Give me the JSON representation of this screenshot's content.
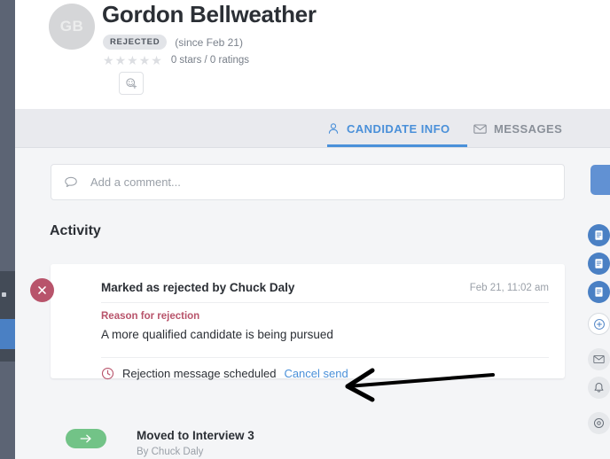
{
  "candidate": {
    "initials": "GB",
    "name": "Gordon Bellweather",
    "status_badge": "REJECTED",
    "status_since": "(since Feb 21)",
    "ratings_text": "0 stars / 0 ratings",
    "star_count": 5,
    "add_reaction_icon": "add-emoji-icon"
  },
  "tabs": [
    {
      "label": "CANDIDATE INFO",
      "icon": "person-icon",
      "active": true
    },
    {
      "label": "MESSAGES",
      "icon": "envelope-icon",
      "active": false
    }
  ],
  "comment": {
    "placeholder": "Add a comment...",
    "icon": "speech-bubble-icon"
  },
  "activity": {
    "heading": "Activity",
    "entries": [
      {
        "icon": "x-circle-icon",
        "title": "Marked as rejected by Chuck Daly",
        "timestamp": "Feb 21, 11:02 am",
        "reason_label": "Reason for rejection",
        "reason_text": "A more qualified candidate is being pursued",
        "scheduled_icon": "clock-icon",
        "scheduled_text": "Rejection message scheduled",
        "cancel_link": "Cancel send"
      },
      {
        "icon": "arrow-right-icon",
        "title": "Moved to Interview 3",
        "byline": "By Chuck Daly"
      }
    ]
  },
  "right_rail": {
    "items": [
      {
        "icon": "panel-toggle-button",
        "style": "blue-button"
      },
      {
        "icon": "document-icon",
        "style": "blue"
      },
      {
        "icon": "document-icon",
        "style": "blue"
      },
      {
        "icon": "document-icon",
        "style": "blue"
      },
      {
        "icon": "clock-plus-icon",
        "style": "ghost"
      },
      {
        "icon": "envelope-icon",
        "style": "gray"
      },
      {
        "icon": "bell-icon",
        "style": "gray"
      },
      {
        "icon": "location-pin-icon",
        "style": "gray"
      }
    ]
  },
  "annotation": {
    "type": "arrow",
    "direction": "left",
    "points_to": "Cancel send"
  },
  "colors": {
    "accent_blue": "#4a90d9",
    "reject_red": "#b8546b",
    "moved_green": "#72c387",
    "rail_slate": "#5c6474",
    "page_bg": "#f4f5f7"
  }
}
